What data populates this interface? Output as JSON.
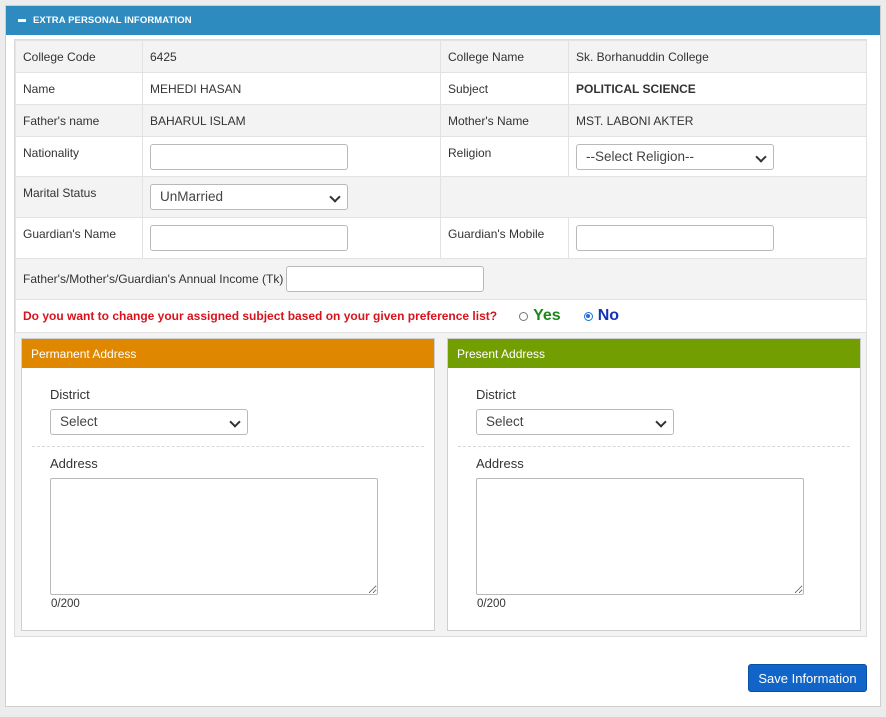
{
  "panel": {
    "title": "EXTRA PERSONAL INFORMATION"
  },
  "info": {
    "college_code_label": "College Code",
    "college_code": "6425",
    "college_name_label": "College Name",
    "college_name": "Sk. Borhanuddin College",
    "name_label": "Name",
    "name": "MEHEDI HASAN",
    "subject_label": "Subject",
    "subject": "POLITICAL SCIENCE",
    "father_label": "Father's name",
    "father": "BAHARUL ISLAM",
    "mother_label": "Mother's Name",
    "mother": "MST. LABONI AKTER",
    "nationality_label": "Nationality",
    "nationality_value": "",
    "religion_label": "Religion",
    "religion_value": "--Select Religion--",
    "marital_label": "Marital Status",
    "marital_value": "UnMarried",
    "guardian_name_label": "Guardian's Name",
    "guardian_name_value": "",
    "guardian_mobile_label": "Guardian's Mobile",
    "guardian_mobile_value": "",
    "income_label": "Father's/Mother's/Guardian's Annual Income (Tk)",
    "income_value": ""
  },
  "question": {
    "text": "Do you want to change your assigned subject based on your given preference list?",
    "yes_label": "Yes",
    "no_label": "No",
    "selected": "No"
  },
  "permanent": {
    "title": "Permanent Address",
    "district_label": "District",
    "district_value": "Select",
    "address_label": "Address",
    "address_value": "",
    "counter": "0/200"
  },
  "present": {
    "title": "Present Address",
    "district_label": "District",
    "district_value": "Select",
    "address_label": "Address",
    "address_value": "",
    "counter": "0/200"
  },
  "save_button": "Save Information",
  "colors": {
    "header": "#2e8bbf",
    "permanent_header": "#e08700",
    "present_header": "#739e02",
    "button": "#1165c9"
  }
}
